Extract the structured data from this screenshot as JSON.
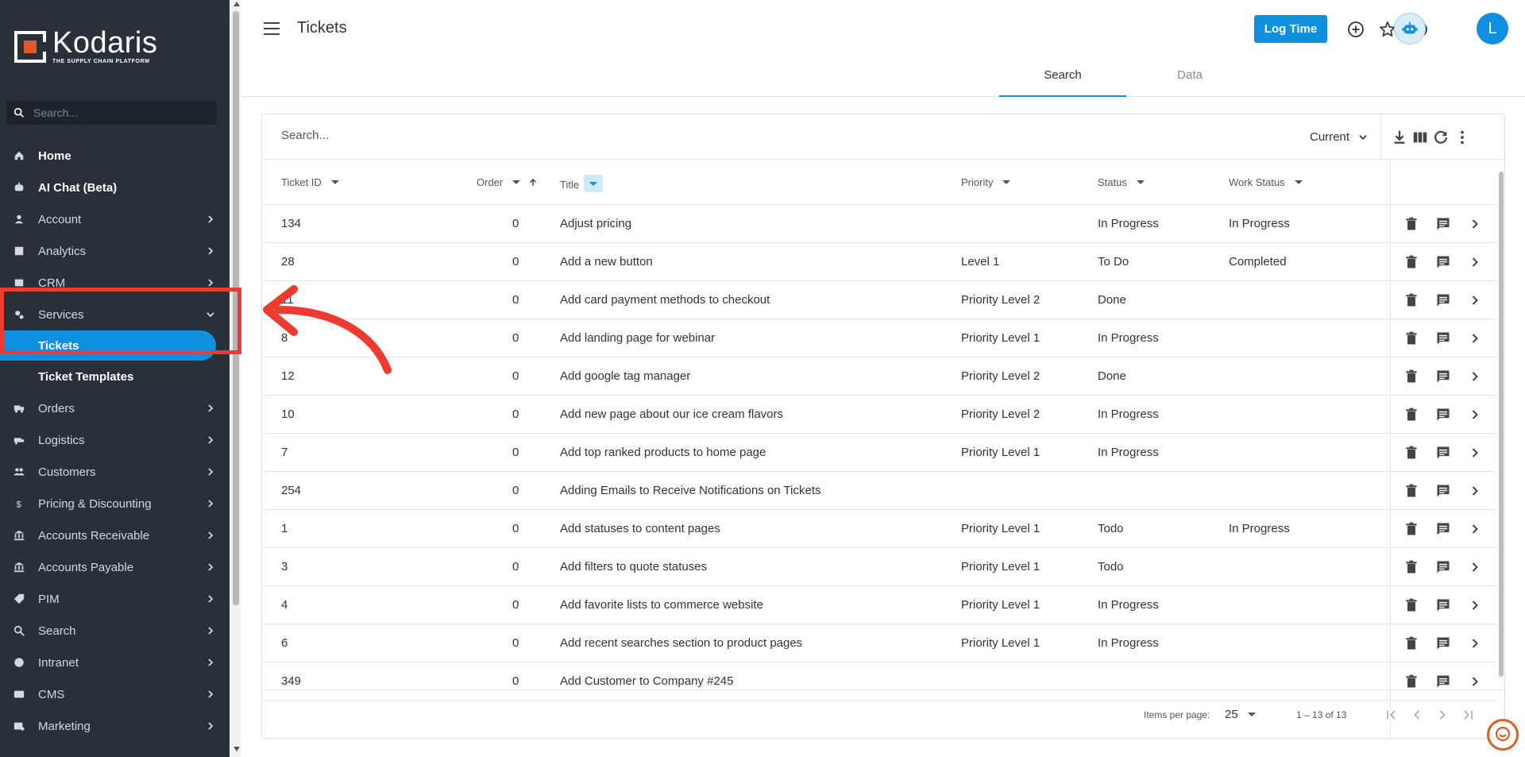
{
  "sidebar": {
    "brand": "Kodaris",
    "tagline": "THE SUPPLY CHAIN PLATFORM",
    "search_placeholder": "Search...",
    "items": [
      {
        "label": "Home",
        "icon": "home-icon"
      },
      {
        "label": "AI Chat (Beta)",
        "icon": "robot-icon"
      },
      {
        "label": "Account",
        "icon": "person-icon"
      },
      {
        "label": "Analytics",
        "icon": "chart-icon"
      },
      {
        "label": "CRM",
        "icon": "crm-icon"
      },
      {
        "label": "Services",
        "icon": "gears-icon"
      },
      {
        "label": "Orders",
        "icon": "truck-icon"
      },
      {
        "label": "Logistics",
        "icon": "delivery-icon"
      },
      {
        "label": "Customers",
        "icon": "people-icon"
      },
      {
        "label": "Pricing & Discounting",
        "icon": "dollar-icon"
      },
      {
        "label": "Accounts Receivable",
        "icon": "bank-icon"
      },
      {
        "label": "Accounts Payable",
        "icon": "bank-icon"
      },
      {
        "label": "PIM",
        "icon": "tag-icon"
      },
      {
        "label": "Search",
        "icon": "search-icon"
      },
      {
        "label": "Intranet",
        "icon": "globe-icon"
      },
      {
        "label": "CMS",
        "icon": "cms-icon"
      },
      {
        "label": "Marketing",
        "icon": "marketing-icon"
      }
    ],
    "sub_items": [
      {
        "label": "Tickets"
      },
      {
        "label": "Ticket Templates"
      }
    ]
  },
  "header": {
    "title": "Tickets",
    "log_time": "Log Time",
    "avatar_initial": "L"
  },
  "tabs": [
    {
      "label": "Search"
    },
    {
      "label": "Data"
    }
  ],
  "table": {
    "search_placeholder": "Search...",
    "view_select": "Current",
    "columns": [
      "Ticket ID",
      "Order",
      "Title",
      "Priority",
      "Status",
      "Work Status"
    ],
    "rows": [
      {
        "id": "134",
        "order": "0",
        "title": "Adjust pricing",
        "priority": "",
        "status": "In Progress",
        "work_status": "In Progress"
      },
      {
        "id": "28",
        "order": "0",
        "title": "Add a new button",
        "priority": "Level 1",
        "status": "To Do",
        "work_status": "Completed"
      },
      {
        "id": "11",
        "order": "0",
        "title": "Add card payment methods to checkout",
        "priority": "Priority Level 2",
        "status": "Done",
        "work_status": ""
      },
      {
        "id": "8",
        "order": "0",
        "title": "Add landing page for webinar",
        "priority": "Priority Level 1",
        "status": "In Progress",
        "work_status": ""
      },
      {
        "id": "12",
        "order": "0",
        "title": "Add google tag manager",
        "priority": "Priority Level 2",
        "status": "Done",
        "work_status": ""
      },
      {
        "id": "10",
        "order": "0",
        "title": "Add new page about our ice cream flavors",
        "priority": "Priority Level 2",
        "status": "In Progress",
        "work_status": ""
      },
      {
        "id": "7",
        "order": "0",
        "title": "Add top ranked products to home page",
        "priority": "Priority Level 1",
        "status": "In Progress",
        "work_status": ""
      },
      {
        "id": "254",
        "order": "0",
        "title": "Adding Emails to Receive Notifications on Tickets",
        "priority": "",
        "status": "",
        "work_status": ""
      },
      {
        "id": "1",
        "order": "0",
        "title": "Add statuses to content pages",
        "priority": "Priority Level 1",
        "status": "Todo",
        "work_status": "In Progress"
      },
      {
        "id": "3",
        "order": "0",
        "title": "Add filters to quote statuses",
        "priority": "Priority Level 1",
        "status": "Todo",
        "work_status": ""
      },
      {
        "id": "4",
        "order": "0",
        "title": "Add favorite lists to commerce website",
        "priority": "Priority Level 1",
        "status": "In Progress",
        "work_status": ""
      },
      {
        "id": "6",
        "order": "0",
        "title": "Add recent searches section to product pages",
        "priority": "Priority Level 1",
        "status": "In Progress",
        "work_status": ""
      },
      {
        "id": "349",
        "order": "0",
        "title": "Add Customer to Company #245",
        "priority": "",
        "status": "",
        "work_status": ""
      }
    ]
  },
  "pager": {
    "items_per_page_label": "Items per page:",
    "items_per_page": "25",
    "range": "1 – 13 of 13"
  },
  "colors": {
    "accent": "#0f8fe0",
    "sidebar_bg": "#2a3039",
    "annotation": "#ee3a2f",
    "brand_orange": "#e0592a"
  }
}
